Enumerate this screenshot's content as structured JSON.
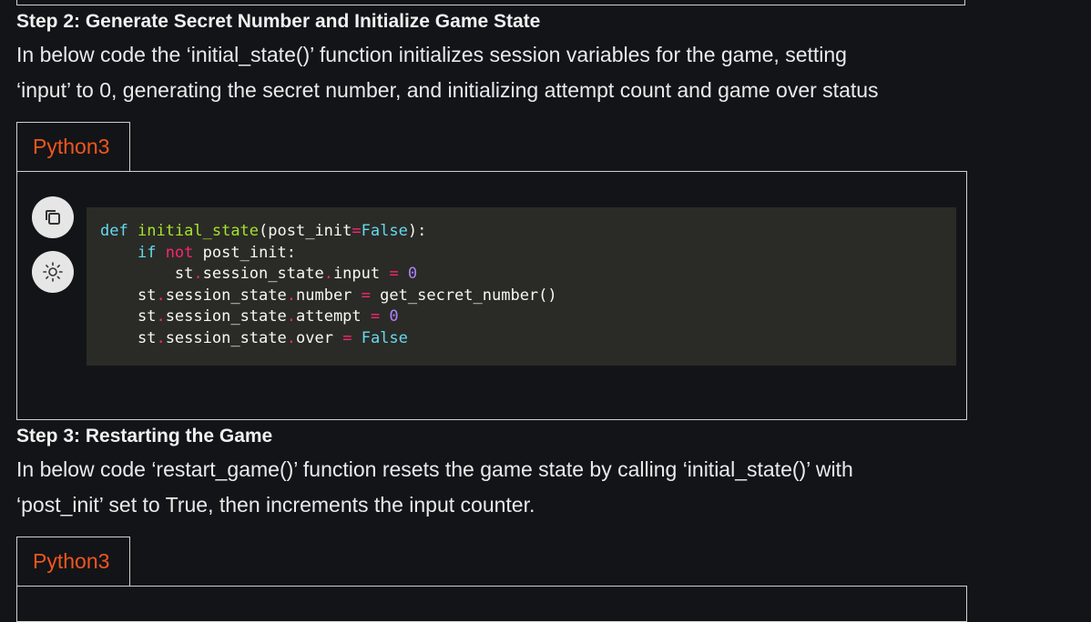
{
  "step2": {
    "title": "Step 2: Generate Secret Number and Initialize Game State",
    "para_line1": "In below code the ‘initial_state()’ function initializes session variables for the game, setting",
    "para_line2": "‘input’ to 0, generating the secret number, and initializing attempt count and game over status",
    "lang_label": "Python3"
  },
  "code": {
    "l1_def": "def",
    "l1_fn": "initial_state",
    "l1_open": "(post_init",
    "l1_eq": "=",
    "l1_false": "False",
    "l1_close": "):",
    "l2_if": "if",
    "l2_not": "not",
    "l2_rest": "post_init:",
    "l3_a": "st",
    "l3_b": "session_state",
    "l3_c": "input",
    "l3_eq": "=",
    "l3_val": "0",
    "l4_a": "st",
    "l4_b": "session_state",
    "l4_c": "number",
    "l4_eq": "=",
    "l4_val": "get_secret_number()",
    "l5_a": "st",
    "l5_b": "session_state",
    "l5_c": "attempt",
    "l5_eq": "=",
    "l5_val": "0",
    "l6_a": "st",
    "l6_b": "session_state",
    "l6_c": "over",
    "l6_eq": "=",
    "l6_val": "False",
    "dot": "."
  },
  "step3": {
    "title": "Step 3: Restarting the Game",
    "para_line1": "In below code ‘restart_game()’ function resets the game state by calling ‘initial_state()’ with",
    "para_line2": "‘post_init’ set to True, then increments the input counter.",
    "lang_label": "Python3"
  },
  "icons": {
    "copy": "copy-icon",
    "theme": "sun-icon"
  },
  "colors": {
    "background": "#131417",
    "lang_accent": "#f0561f",
    "code_bg": "#2a2b26"
  }
}
